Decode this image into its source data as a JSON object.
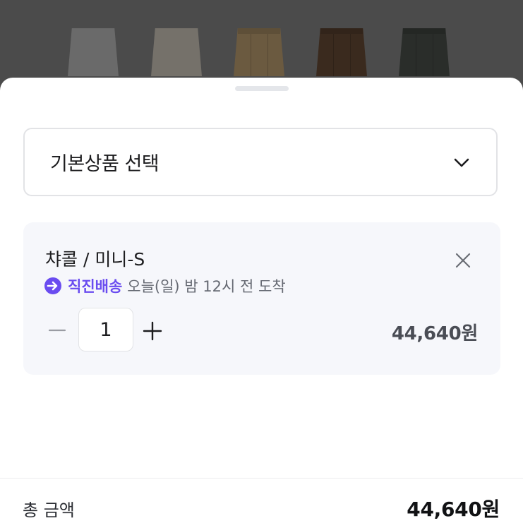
{
  "backdrop": {
    "thumbnails": [
      {
        "color": "#6a6a6a",
        "name": "option-thumbnail-1"
      },
      {
        "color": "#75716a",
        "name": "option-thumbnail-2"
      },
      {
        "color": "#6b5a40",
        "name": "option-thumbnail-3"
      },
      {
        "color": "#3a2a1e",
        "name": "option-thumbnail-4"
      },
      {
        "color": "#2a2d2a",
        "name": "option-thumbnail-5"
      }
    ]
  },
  "selector": {
    "label": "기본상품 선택",
    "icon": "chevron-down-icon"
  },
  "selected_option": {
    "name": "챠콜 / 미니-S",
    "delivery_brand": "직진배송",
    "delivery_text": "오늘(일) 밤 12시 전 도착",
    "delivery_icon": "arrow-circle-icon",
    "quantity": "1",
    "price": "44,640원",
    "remove_icon": "close-icon",
    "minus_icon": "minus-icon",
    "plus_icon": "plus-icon"
  },
  "footer": {
    "total_label": "총 금액",
    "total_value": "44,640원"
  },
  "colors": {
    "accent": "#6a4cf0",
    "card_bg": "#f6f7fb",
    "text_primary": "#1c1c1e",
    "text_secondary": "#666a73"
  }
}
